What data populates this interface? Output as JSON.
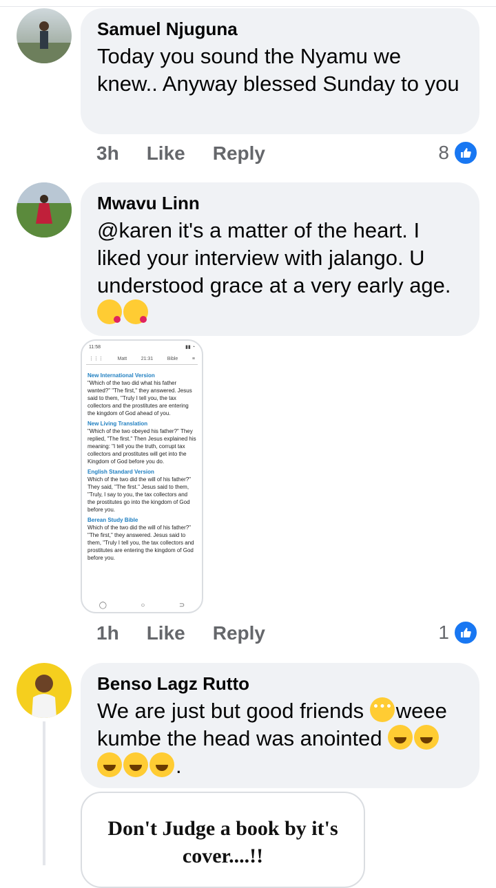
{
  "comments": [
    {
      "author": "Samuel Njuguna",
      "text": "Today you sound the Nyamu we knew.. Anyway blessed Sunday to you",
      "time": "3h",
      "like_label": "Like",
      "reply_label": "Reply",
      "like_count": "8"
    },
    {
      "author": "Mwavu Linn",
      "text": "@karen it's a matter of the heart. I liked your interview with jalango. U understood grace at a very early age.",
      "emoji": [
        "kissing-heart",
        "kissing-heart"
      ],
      "time": "1h",
      "like_label": "Like",
      "reply_label": "Reply",
      "like_count": "1",
      "attachment": {
        "status_time": "11:58",
        "tab_book": "Matt",
        "tab_ref": "21:31",
        "tab_mode": "Bible",
        "versions": [
          {
            "name": "New International Version",
            "text": "\"Which of the two did what his father wanted?\" \"The first,\" they answered. Jesus said to them, \"Truly I tell you, the tax collectors and the prostitutes are entering the kingdom of God ahead of you."
          },
          {
            "name": "New Living Translation",
            "text": "\"Which of the two obeyed his father?\" They replied, \"The first.\" Then Jesus explained his meaning: \"I tell you the truth, corrupt tax collectors and prostitutes will get into the Kingdom of God before you do."
          },
          {
            "name": "English Standard Version",
            "text": "Which of the two did the will of his father?\" They said, \"The first.\" Jesus said to them, \"Truly, I say to you, the tax collectors and the prostitutes go into the kingdom of God before you."
          },
          {
            "name": "Berean Study Bible",
            "text": "Which of the two did the will of his father?\" \"The first,\" they answered. Jesus said to them, \"Truly I tell you, the tax collectors and prostitutes are entering the kingdom of God before you."
          }
        ]
      }
    },
    {
      "author": "Benso Lagz Rutto",
      "text_part1": "We are just but good friends ",
      "text_part2": "weee kumbe the head was anointed ",
      "text_end": ".",
      "emoji": [
        "flushed",
        "rolling-laughing",
        "rolling-laughing",
        "rolling-laughing",
        "rolling-laughing",
        "rolling-laughing"
      ],
      "image_text": "Don't Judge a book by it's cover....!!"
    }
  ],
  "colors": {
    "bubble": "#f0f2f5",
    "like_blue": "#1877f2",
    "meta_gray": "#65676b",
    "version_blue": "#1f7fc1"
  }
}
